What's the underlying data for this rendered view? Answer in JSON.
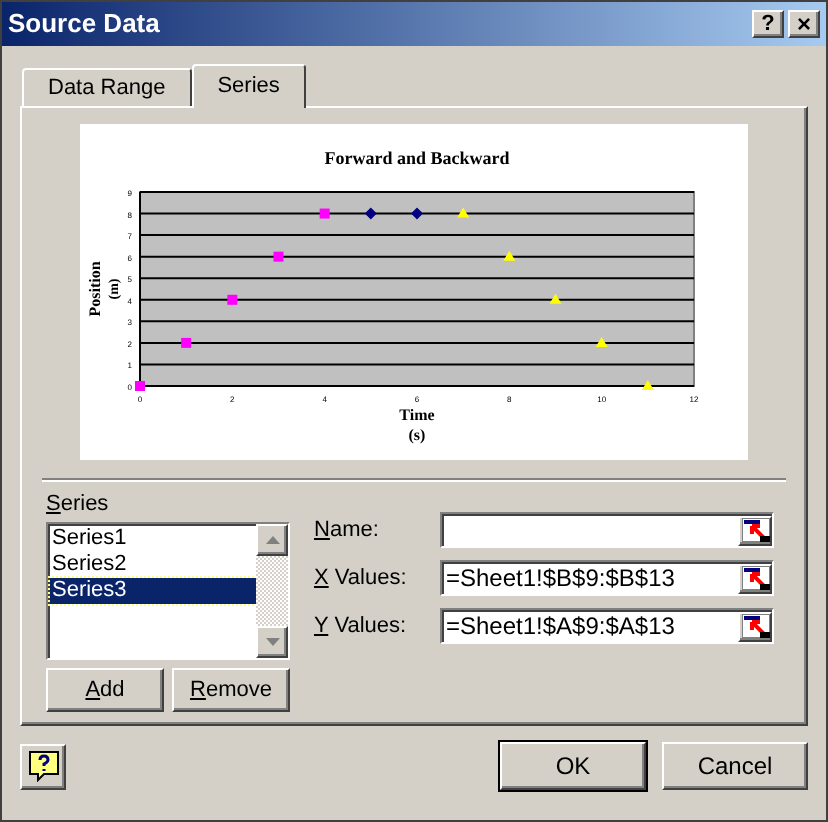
{
  "window": {
    "title": "Source Data",
    "help_button": "?",
    "close_button": "×"
  },
  "tabs": [
    {
      "label": "Data Range",
      "selected": false
    },
    {
      "label": "Series",
      "selected": true
    }
  ],
  "chart": {
    "chart_data": {
      "type": "scatter",
      "title": "Forward and Backward",
      "xlabel": "Time (s)",
      "ylabel": "Position (m)",
      "grid": true,
      "xlim": [
        0,
        12
      ],
      "ylim": [
        0,
        9
      ],
      "xticks": [
        0,
        2,
        4,
        6,
        8,
        10,
        12
      ],
      "yticks": [
        0,
        1,
        2,
        3,
        4,
        5,
        6,
        7,
        8,
        9
      ],
      "series": [
        {
          "color": "#ff00ff",
          "marker": "square",
          "x": [
            0,
            1,
            2,
            3,
            4
          ],
          "values": [
            0,
            2,
            4,
            6,
            8
          ]
        },
        {
          "color": "#000080",
          "marker": "diamond",
          "x": [
            5,
            6
          ],
          "values": [
            8,
            8
          ]
        },
        {
          "color": "#ffff00",
          "marker": "triangle",
          "x": [
            7,
            8,
            9,
            10,
            11
          ],
          "values": [
            8,
            6,
            4,
            2,
            0
          ]
        }
      ]
    }
  },
  "series_list": {
    "label": "Series",
    "items": [
      {
        "label": "Series1",
        "selected": false
      },
      {
        "label": "Series2",
        "selected": false
      },
      {
        "label": "Series3",
        "selected": true
      }
    ]
  },
  "series_buttons": [
    "Add",
    "Remove"
  ],
  "fields": [
    {
      "label": "Name:"
    },
    {
      "label": "X Values:",
      "value": "=Sheet1!$B$9:$B$13"
    },
    {
      "label": "Y Values:",
      "value": "=Sheet1!$A$9:$A$13"
    }
  ],
  "buttons": [
    {
      "label": "OK",
      "default": true
    },
    {
      "label": "Cancel",
      "default": false
    }
  ]
}
